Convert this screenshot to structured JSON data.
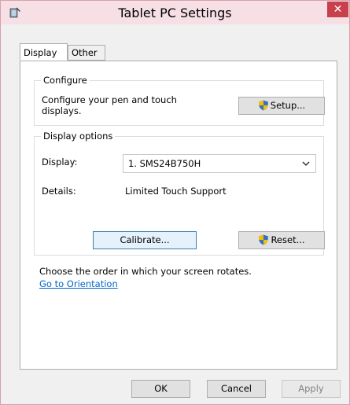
{
  "window": {
    "title": "Tablet PC Settings",
    "close_label": "✕"
  },
  "tabs": [
    {
      "label": "Display",
      "active": true
    },
    {
      "label": "Other",
      "active": false
    }
  ],
  "configure": {
    "group_title": "Configure",
    "description": "Configure your pen and touch displays.",
    "setup_button": "Setup..."
  },
  "display_options": {
    "group_title": "Display options",
    "display_label": "Display:",
    "display_value": "1. SMS24B750H",
    "details_label": "Details:",
    "details_value": "Limited Touch Support",
    "calibrate_button": "Calibrate...",
    "reset_button": "Reset..."
  },
  "orientation": {
    "text": "Choose the order in which your screen rotates.",
    "link": "Go to Orientation"
  },
  "footer": {
    "ok": "OK",
    "cancel": "Cancel",
    "apply": "Apply"
  },
  "colors": {
    "link": "#0066cc",
    "close": "#c7404c",
    "titlebar": "#f7dfe6"
  },
  "icons": {
    "app": "tablet-pc-icon",
    "shield": "uac-shield-icon",
    "dropdown": "chevron-down-icon"
  }
}
